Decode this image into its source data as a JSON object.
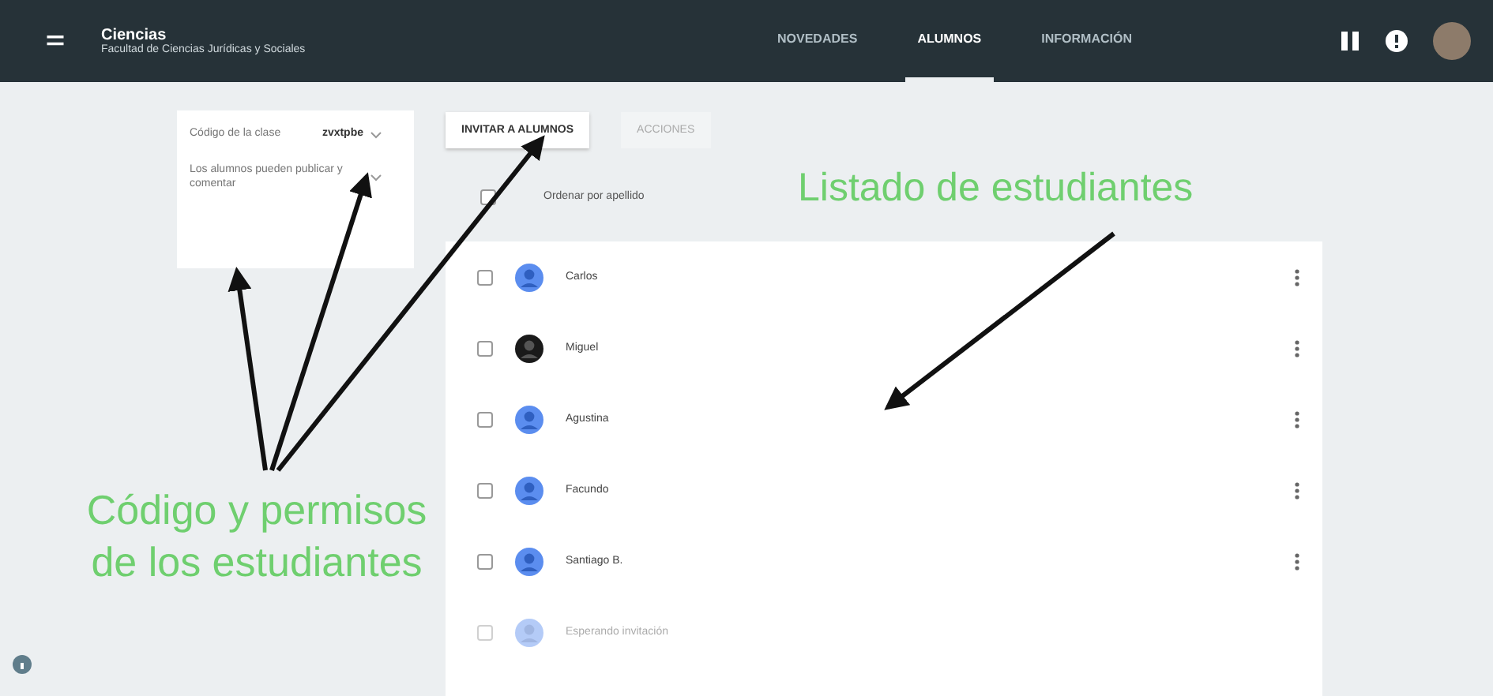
{
  "header": {
    "title": "Ciencias",
    "subtitle": "Facultad de Ciencias Jurídicas y Sociales",
    "tabs": [
      {
        "label": "NOVEDADES",
        "selected": false
      },
      {
        "label": "ALUMNOS",
        "selected": true
      },
      {
        "label": "INFORMACIÓN",
        "selected": false
      }
    ]
  },
  "settings": [
    {
      "label": "Código de la clase",
      "value": "zvxtpbe"
    },
    {
      "label": "Los alumnos pueden publicar y comentar"
    }
  ],
  "toolbar": {
    "invite": "INVITAR A ALUMNOS",
    "actions": "ACCIONES"
  },
  "sort": {
    "label": "Ordenar por apellido",
    "checked": false
  },
  "students": [
    {
      "name": "Carlos",
      "kind": "default",
      "checked": false,
      "pending": false
    },
    {
      "name": "Miguel",
      "kind": "photo",
      "checked": false,
      "pending": false
    },
    {
      "name": "Agustina",
      "kind": "default",
      "checked": false,
      "pending": false
    },
    {
      "name": "Facundo",
      "kind": "default",
      "checked": false,
      "pending": false
    },
    {
      "name": "Santiago B.",
      "kind": "default",
      "checked": false,
      "pending": false
    },
    {
      "name": "Esperando invitación",
      "kind": "default",
      "checked": false,
      "pending": true
    }
  ],
  "annotations": {
    "list": "Listado de estudiantes",
    "settings": "Código y permisos de los estudiantes"
  }
}
